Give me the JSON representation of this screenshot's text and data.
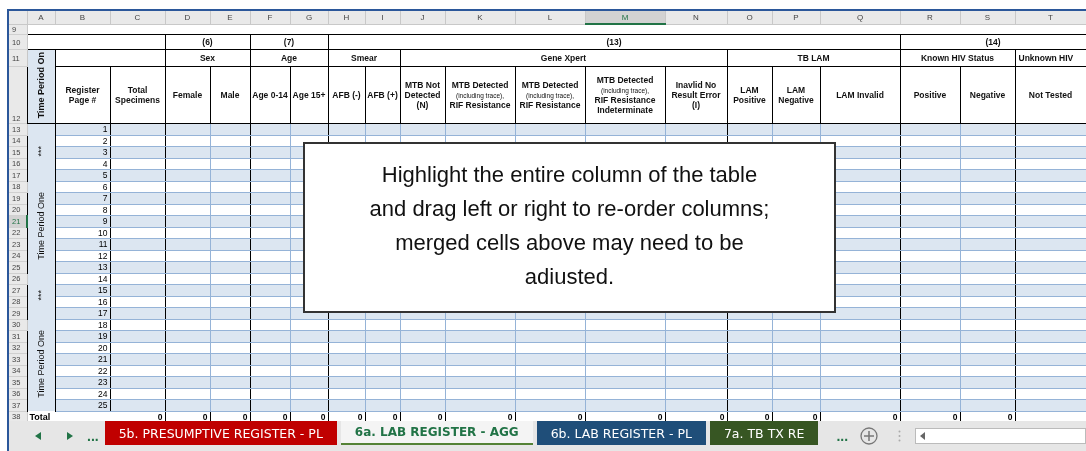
{
  "column_letters": [
    {
      "label": "A",
      "selected": false
    },
    {
      "label": "B",
      "selected": false
    },
    {
      "label": "C",
      "selected": false
    },
    {
      "label": "D",
      "selected": false
    },
    {
      "label": "E",
      "selected": false
    },
    {
      "label": "F",
      "selected": false
    },
    {
      "label": "G",
      "selected": false
    },
    {
      "label": "H",
      "selected": false
    },
    {
      "label": "I",
      "selected": false
    },
    {
      "label": "J",
      "selected": false
    },
    {
      "label": "K",
      "selected": false
    },
    {
      "label": "L",
      "selected": false
    },
    {
      "label": "M",
      "selected": true
    },
    {
      "label": "N",
      "selected": false
    },
    {
      "label": "O",
      "selected": false
    },
    {
      "label": "P",
      "selected": false
    },
    {
      "label": "Q",
      "selected": false
    },
    {
      "label": "R",
      "selected": false
    },
    {
      "label": "S",
      "selected": false
    },
    {
      "label": "T",
      "selected": false
    }
  ],
  "header_rows": [
    {
      "number": "9",
      "selected": false
    },
    {
      "number": "10",
      "selected": false
    },
    {
      "number": "11",
      "selected": false
    },
    {
      "number": "12",
      "selected": false
    }
  ],
  "group_numbers": [
    "(6)",
    "(7)",
    "(13)",
    "(14)"
  ],
  "groups": [
    "Sex",
    "Age",
    "Smear",
    "Gene Xpert",
    "TB LAM",
    "Known HIV Status",
    "Unknown HIV"
  ],
  "headings": [
    {
      "text": "Register Page #"
    },
    {
      "text": "Total Specimens"
    },
    {
      "text": "Female"
    },
    {
      "text": "Male"
    },
    {
      "text": "Age 0-14"
    },
    {
      "text": "Age 15+"
    },
    {
      "text": "AFB (-)"
    },
    {
      "text": "AFB (+)"
    },
    {
      "text": "MTB Not Detected (N)"
    },
    {
      "text": "MTB Detected",
      "note": "(including trace),",
      "text_after": "RIF Resistance"
    },
    {
      "text": "MTB Detected",
      "note": "(including trace),",
      "text_after": "RIF Resistance"
    },
    {
      "text": "MTB Detected",
      "note": "(including trace),",
      "text_after": "RIF Resistance Indeterminate"
    },
    {
      "text": "Inavlid No Result Error (I)"
    },
    {
      "text": "LAM Positive"
    },
    {
      "text": "LAM Negative"
    },
    {
      "text": "LAM Invalid"
    },
    {
      "text": "Positive"
    },
    {
      "text": "Negative"
    },
    {
      "text": "Not Tested"
    }
  ],
  "side_labels": [
    "Time Period On",
    "***",
    "Time Period One",
    "***",
    "Time Period One"
  ],
  "data_rows": [
    {
      "number": "13",
      "selected": false,
      "page": "1"
    },
    {
      "number": "14",
      "selected": false,
      "page": "2"
    },
    {
      "number": "15",
      "selected": false,
      "page": "3"
    },
    {
      "number": "16",
      "selected": false,
      "page": "4"
    },
    {
      "number": "17",
      "selected": false,
      "page": "5"
    },
    {
      "number": "18",
      "selected": false,
      "page": "6"
    },
    {
      "number": "19",
      "selected": false,
      "page": "7"
    },
    {
      "number": "20",
      "selected": false,
      "page": "8"
    },
    {
      "number": "21",
      "selected": true,
      "page": "9"
    },
    {
      "number": "22",
      "selected": false,
      "page": "10"
    },
    {
      "number": "23",
      "selected": false,
      "page": "11"
    },
    {
      "number": "24",
      "selected": false,
      "page": "12"
    },
    {
      "number": "25",
      "selected": false,
      "page": "13"
    },
    {
      "number": "26",
      "selected": false,
      "page": "14"
    },
    {
      "number": "27",
      "selected": false,
      "page": "15"
    },
    {
      "number": "28",
      "selected": false,
      "page": "16"
    },
    {
      "number": "29",
      "selected": false,
      "page": "17"
    },
    {
      "number": "30",
      "selected": false,
      "page": "18"
    },
    {
      "number": "31",
      "selected": false,
      "page": "19"
    },
    {
      "number": "32",
      "selected": false,
      "page": "20"
    },
    {
      "number": "33",
      "selected": false,
      "page": "21"
    },
    {
      "number": "34",
      "selected": false,
      "page": "22"
    },
    {
      "number": "35",
      "selected": false,
      "page": "23"
    },
    {
      "number": "36",
      "selected": false,
      "page": "24"
    },
    {
      "number": "37",
      "selected": false,
      "page": "25"
    }
  ],
  "total_row": {
    "number": "38",
    "selected": false,
    "label": "Total",
    "values": [
      "0",
      "0",
      "0",
      "0",
      "0",
      "0",
      "0",
      "0",
      "0",
      "0",
      "0",
      "0",
      "0",
      "0",
      "0",
      "0",
      "0"
    ]
  },
  "callout": {
    "text": "Highlight the entire column of the table and drag left or right to re-order columns; merged cells above may need to be adiusted."
  },
  "sheet_tabs": {
    "more_left": "...",
    "more_right": "...",
    "tabs": [
      {
        "label": "5b. PRESUMPTIVE REGISTER -  PL",
        "color": "#c00000",
        "selected": false
      },
      {
        "label": "6a. LAB REGISTER - AGG",
        "color": "#548235",
        "selected": true
      },
      {
        "label": "6b. LAB REGISTER - PL",
        "color": "#1f4e79",
        "selected": false
      },
      {
        "label": "7a. TB TX RE",
        "color": "#375623",
        "selected": false
      }
    ]
  }
}
